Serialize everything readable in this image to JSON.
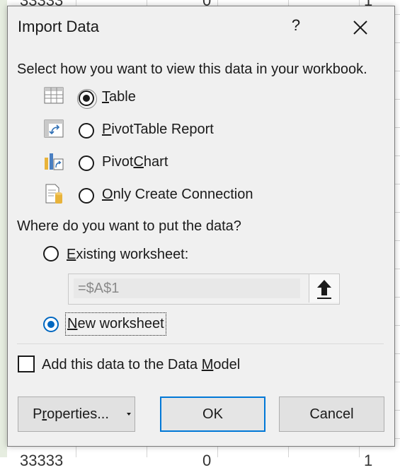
{
  "background": {
    "peek_top": [
      "33333",
      "0",
      "1"
    ],
    "peek_bottom": [
      "33333",
      "0",
      "1"
    ]
  },
  "dialog": {
    "title": "Import Data",
    "help_label": "?",
    "view_prompt": "Select how you want to view this data in your workbook.",
    "view_options": [
      {
        "key": "T",
        "rest": "able",
        "pre": "",
        "icon": "table-icon",
        "selected": true
      },
      {
        "pre": "",
        "key": "P",
        "rest": "ivotTable Report",
        "icon": "pivottable-icon",
        "selected": false
      },
      {
        "pre": "Pivot",
        "key": "C",
        "rest": "hart",
        "icon": "pivotchart-icon",
        "selected": false
      },
      {
        "pre": "",
        "key": "O",
        "rest": "nly Create Connection",
        "icon": "connection-icon",
        "selected": false
      }
    ],
    "location_prompt": "Where do you want to put the data?",
    "existing_worksheet": {
      "key": "E",
      "rest": "xisting worksheet:",
      "selected": false
    },
    "reference_value": "=$A$1",
    "new_worksheet": {
      "key": "N",
      "rest": "ew worksheet",
      "selected": true
    },
    "data_model": {
      "pre": "Add this data to the Data ",
      "key": "M",
      "rest": "odel",
      "checked": false
    },
    "buttons": {
      "properties": {
        "pre": "P",
        "key": "r",
        "rest": "operties..."
      },
      "ok": "OK",
      "cancel": "Cancel"
    }
  },
  "colors": {
    "dialog_bg": "#f0f0f0",
    "accent": "#0078d7",
    "radio_selected_blue": "#0067c0"
  }
}
